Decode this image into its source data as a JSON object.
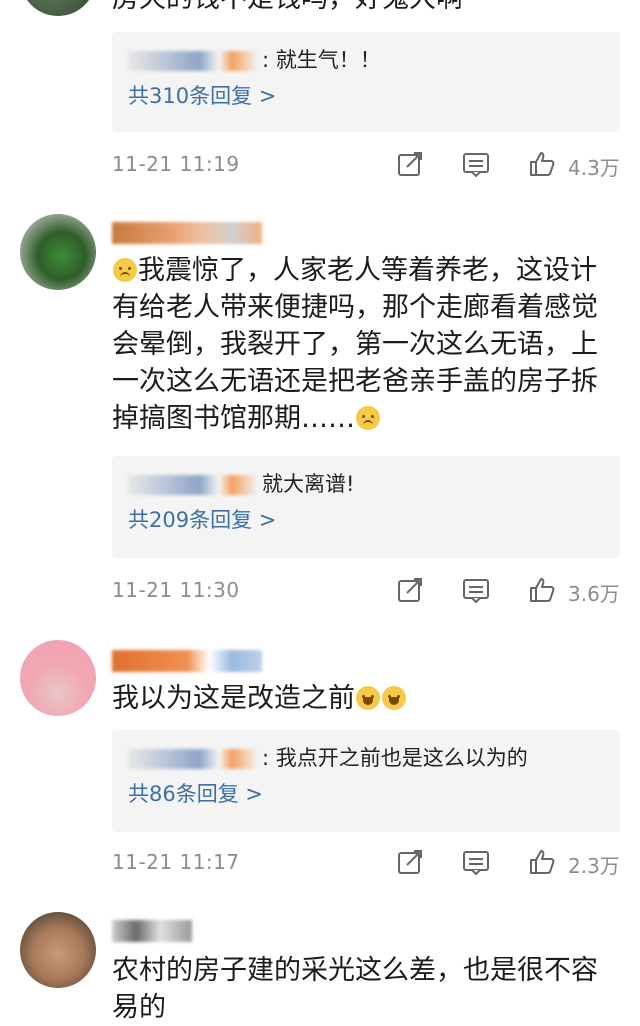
{
  "comments": [
    {
      "text": "房天的钱不是钱吗，好鬼大啊",
      "reply": {
        "text": ": 就生气！！",
        "count_label": "共310条回复 >"
      },
      "time": "11-21 11:19",
      "likes": "4.3万"
    },
    {
      "text_a": "我震惊了，人家老人等着养老，这设计有给老人带来便捷吗，那个走廊看着感觉会晕倒，我裂开了，第一次这么无语，上一次这么无语还是把老爸亲手盖的房子拆掉搞图书馆那期……",
      "reply": {
        "text": "就大离谱!",
        "count_label": "共209条回复 >"
      },
      "time": "11-21 11:30",
      "likes": "3.6万"
    },
    {
      "text": "我以为这是改造之前",
      "reply": {
        "text": ": 我点开之前也是这么以为的",
        "count_label": "共86条回复 >"
      },
      "time": "11-21 11:17",
      "likes": "2.3万"
    },
    {
      "text": "农村的房子建的采光这么差，也是很不容易的"
    }
  ],
  "icons": {
    "share": "share-icon",
    "comment": "comment-icon",
    "like": "thumbs-up-icon"
  },
  "colors": {
    "link": "#3d6ea8",
    "meta": "#8c8c8c",
    "reply_bg": "#f4f4f4"
  }
}
